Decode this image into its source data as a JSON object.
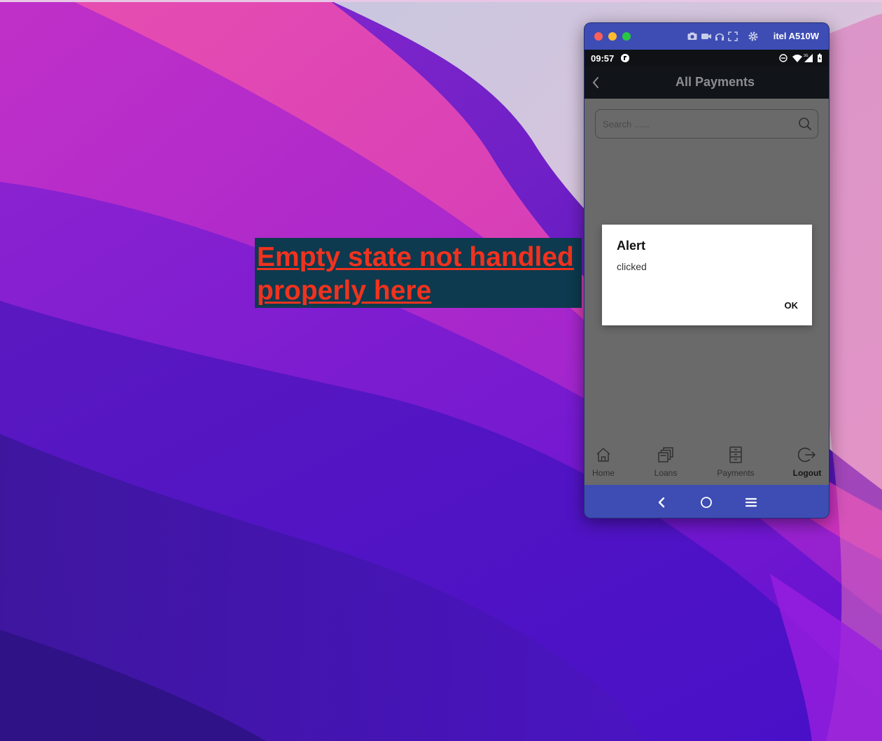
{
  "annotation": {
    "text": "Empty state not handled properly here"
  },
  "emulator": {
    "device_name": "itel A510W",
    "toolbar_icons": [
      "camera-icon",
      "video-icon",
      "headphones-icon",
      "fullscreen-icon",
      "settings-icon"
    ]
  },
  "statusbar": {
    "time": "09:57",
    "icons": [
      "app-notification-icon",
      "dnd-icon",
      "wifi-icon",
      "signal-icon",
      "battery-icon"
    ]
  },
  "appbar": {
    "title": "All Payments"
  },
  "search": {
    "placeholder": "Search ......"
  },
  "dialog": {
    "title": "Alert",
    "message": "clicked",
    "ok_label": "OK"
  },
  "bottom_nav": {
    "items": [
      {
        "label": "Home",
        "icon": "home-icon",
        "active": false
      },
      {
        "label": "Loans",
        "icon": "loans-icon",
        "active": false
      },
      {
        "label": "Payments",
        "icon": "payments-icon",
        "active": false
      },
      {
        "label": "Logout",
        "icon": "logout-icon",
        "active": true
      }
    ]
  },
  "colors": {
    "annotation_bg": "#0d3a4e",
    "annotation_text": "#f1321e",
    "emulator_chrome": "#3d4db4",
    "appbar_bg": "#111418",
    "screen_dim": "#6a6a6a"
  }
}
